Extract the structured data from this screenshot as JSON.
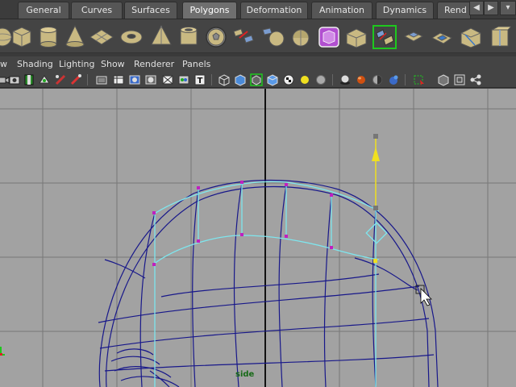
{
  "shelf_tabs": [
    {
      "label": "General"
    },
    {
      "label": "Curves"
    },
    {
      "label": "Surfaces"
    },
    {
      "label": "Polygons",
      "active": true
    },
    {
      "label": "Deformation"
    },
    {
      "label": "Animation"
    },
    {
      "label": "Dynamics"
    },
    {
      "label": "Rend"
    }
  ],
  "shelf_icons": [
    "sphere-icon",
    "cube-icon",
    "cylinder-icon",
    "cone-icon",
    "plane-icon",
    "torus-icon",
    "prism-icon",
    "pipe-icon",
    "soccer-ball-icon",
    "combine-icon",
    "separate-icon",
    "extract-icon",
    "smooth-icon",
    "smooth-proxy-icon",
    "bridge-icon",
    "extrude-icon",
    "append-icon",
    "split-icon",
    "insert-loop-icon"
  ],
  "panel_menu": {
    "view": "w",
    "shading": "Shading",
    "lighting": "Lighting",
    "show": "Show",
    "renderer": "Renderer",
    "panels": "Panels"
  },
  "viewport": {
    "camera_label": "side",
    "background": "#a2a2a2",
    "grid_color": "#777777",
    "wire_color": "#18188a",
    "highlight_color": "#7ee6ee",
    "manipulator_color": "#f0e020"
  },
  "colors": {
    "ui_bg": "#444444",
    "tab_bg": "#565656",
    "tab_active": "#6f6f6f"
  }
}
